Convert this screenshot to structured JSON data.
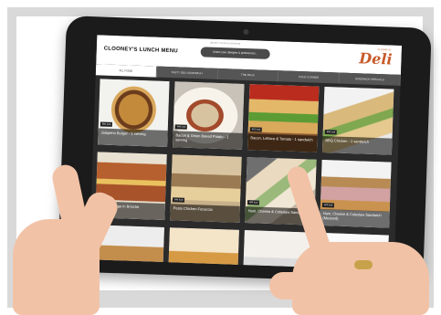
{
  "app": {
    "title": "CLOONEY'S LUNCH MENU",
    "allergen_caption": "SELECT YOUR ALLERGENS",
    "allergen_prompt": "Select your allergies & preferences...",
    "logo": {
      "script": "Deli",
      "small": "CLOONEY'S"
    }
  },
  "tabs": [
    {
      "label": "ALL FOOD",
      "active": true
    },
    {
      "label": "TASTY DELI SANDWICH",
      "active": false
    },
    {
      "label": "THE PACK",
      "active": false
    },
    {
      "label": "COLD CORNER",
      "active": false
    },
    {
      "label": "SANDWICH SPECIALS",
      "active": false
    }
  ],
  "items": [
    {
      "caption": "Jalapeno Burger - 1 serving",
      "kcal": "850 kcal",
      "look": "f1"
    },
    {
      "caption": "Bacon & Onion Baked Potato - 1 serving",
      "kcal": "460 kcal",
      "look": "f2"
    },
    {
      "caption": "Bacon, Lettuce & Tomato - 1 sandwich",
      "kcal": "510 kcal",
      "look": "f3"
    },
    {
      "caption": "BBQ Chicken - 1 sandwich",
      "kcal": "390 kcal",
      "look": "f4"
    },
    {
      "caption": "BBQ Sausage In Brioche",
      "kcal": "720 kcal",
      "look": "f5"
    },
    {
      "caption": "Pesto Chicken Focaccia",
      "kcal": "640 kcal",
      "look": "f6"
    },
    {
      "caption": "Ham, Cheese & Coleslaw Sandwich",
      "kcal": "480 kcal",
      "look": "f7"
    },
    {
      "caption": "Ham, Cheese & Coleslaw Sandwich (Mustard)",
      "kcal": "500 kcal",
      "look": "f8"
    },
    {
      "caption": "",
      "kcal": "",
      "look": "f9"
    },
    {
      "caption": "",
      "kcal": "",
      "look": "f10"
    },
    {
      "caption": "",
      "kcal": "",
      "look": "f11"
    },
    {
      "caption": "",
      "kcal": "",
      "look": "f12"
    }
  ]
}
